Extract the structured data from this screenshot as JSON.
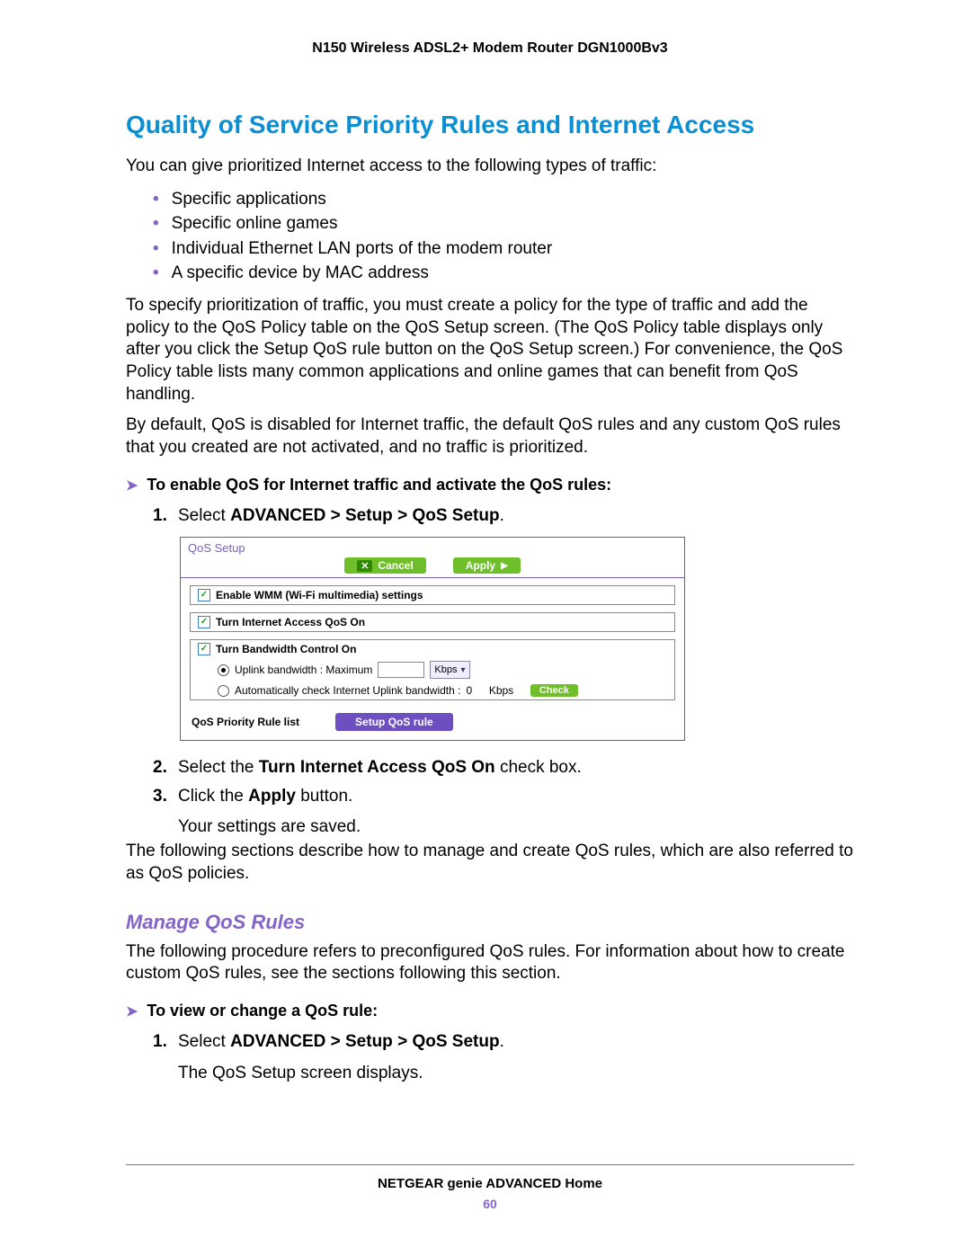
{
  "header": {
    "product": "N150 Wireless ADSL2+ Modem Router DGN1000Bv3"
  },
  "h1": "Quality of Service Priority Rules and Internet Access",
  "intro": "You can give prioritized Internet access to the following types of traffic:",
  "traffic_types": [
    "Specific applications",
    "Specific online games",
    "Individual Ethernet LAN ports of the modem router",
    "A specific device by MAC address"
  ],
  "para2": "To specify prioritization of traffic, you must create a policy for the type of traffic and add the policy to the QoS Policy table on the QoS Setup screen. (The QoS Policy table displays only after you click the Setup QoS rule button on the QoS Setup screen.) For convenience, the QoS Policy table lists many common applications and online games that can benefit from QoS handling.",
  "para3": "By default, QoS is disabled for Internet traffic, the default QoS rules and any custom QoS rules that you created are not activated, and no traffic is prioritized.",
  "proc1": {
    "title": "To enable QoS for Internet traffic and activate the QoS rules:",
    "step1_pre": "Select ",
    "step1_bold": "ADVANCED > Setup > QoS Setup",
    "step1_post": ".",
    "step2_pre": "Select the ",
    "step2_bold": "Turn Internet Access QoS On",
    "step2_post": " check box.",
    "step3_pre": "Click the ",
    "step3_bold": "Apply",
    "step3_post": " button.",
    "step3_sub": "Your settings are saved."
  },
  "para4": "The following sections describe how to manage and create QoS rules, which are also referred to as QoS policies.",
  "h2": "Manage QoS Rules",
  "para5": "The following procedure refers to preconfigured QoS rules. For information about how to create custom QoS rules, see the sections following this section.",
  "proc2": {
    "title": "To view or change a QoS rule:",
    "step1_pre": "Select ",
    "step1_bold": "ADVANCED > Setup > QoS Setup",
    "step1_post": ".",
    "step1_sub": "The QoS Setup screen displays."
  },
  "figure": {
    "title": "QoS Setup",
    "cancel": "Cancel",
    "apply": "Apply",
    "wmm": "Enable WMM (Wi-Fi multimedia) settings",
    "internet_qos": "Turn Internet Access QoS On",
    "bw_control": "Turn Bandwidth Control On",
    "uplink_label": "Uplink bandwidth :   Maximum",
    "uplink_unit": "Kbps",
    "auto_label": "Automatically check Internet Uplink bandwidth :",
    "auto_value": "0",
    "auto_unit": "Kbps",
    "check_btn": "Check",
    "rule_list": "QoS Priority Rule list",
    "setup_btn": "Setup QoS rule"
  },
  "footer": {
    "title": "NETGEAR genie ADVANCED Home",
    "page": "60"
  }
}
